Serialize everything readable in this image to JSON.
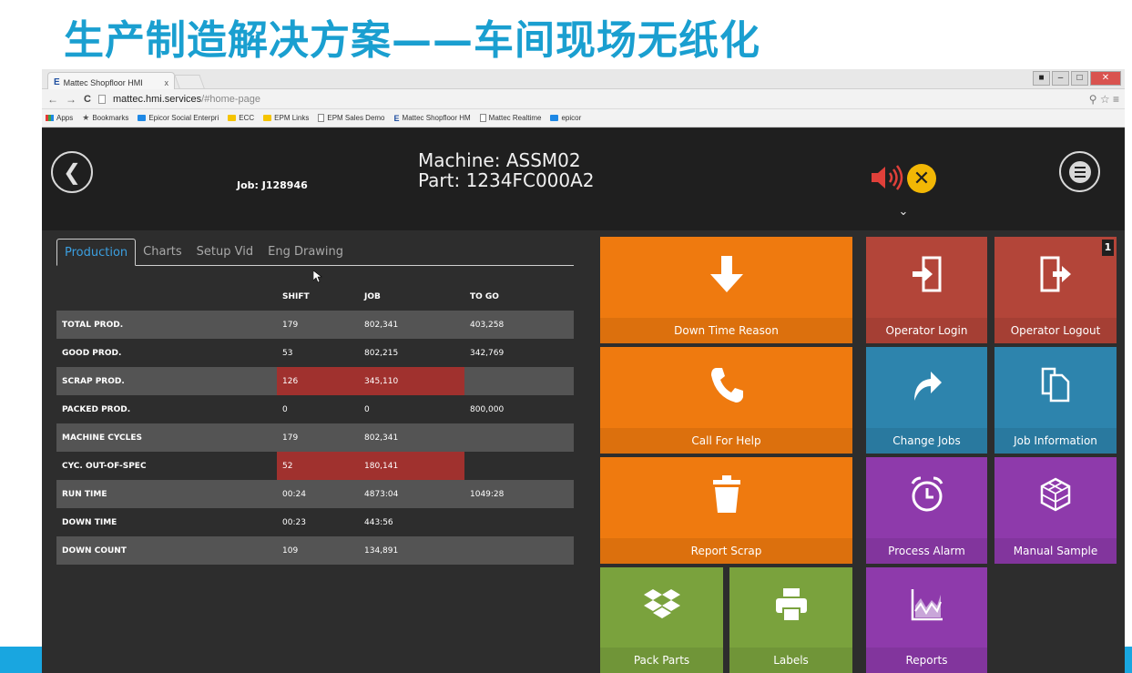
{
  "slide": {
    "title": "生产制造解决方案——车间现场无纸化"
  },
  "browser": {
    "tab_title": "Mattec Shopfloor HMI",
    "tab_close": "x",
    "url_host": "mattec.hmi.services",
    "url_path": "/#home-page",
    "bookmarks": [
      "Apps",
      "Bookmarks",
      "Epicor Social Enterpri",
      "ECC",
      "EPM Links",
      "EPM Sales Demo",
      "Mattec Shopfloor HM",
      "Mattec Realtime",
      "epicor"
    ]
  },
  "header": {
    "job": "Job: J128946",
    "machine": "Machine: ASSM02",
    "part": "Part: 1234FC000A2"
  },
  "tabs": [
    {
      "label": "Production",
      "active": true
    },
    {
      "label": "Charts",
      "active": false
    },
    {
      "label": "Setup Vid",
      "active": false
    },
    {
      "label": "Eng Drawing",
      "active": false
    }
  ],
  "table": {
    "columns": [
      "SHIFT",
      "JOB",
      "TO GO"
    ],
    "rows": [
      {
        "label": "TOTAL PROD.",
        "shift": "179",
        "job": "802,341",
        "togo": "403,258",
        "alert": false
      },
      {
        "label": "GOOD PROD.",
        "shift": "53",
        "job": "802,215",
        "togo": "342,769",
        "alert": false
      },
      {
        "label": "SCRAP PROD.",
        "shift": "126",
        "job": "345,110",
        "togo": "",
        "alert": true
      },
      {
        "label": "PACKED PROD.",
        "shift": "0",
        "job": "0",
        "togo": "800,000",
        "alert": false
      },
      {
        "label": "MACHINE CYCLES",
        "shift": "179",
        "job": "802,341",
        "togo": "",
        "alert": false
      },
      {
        "label": "CYC. OUT-OF-SPEC",
        "shift": "52",
        "job": "180,141",
        "togo": "",
        "alert": true
      },
      {
        "label": "RUN TIME",
        "shift": "00:24",
        "job": "4873:04",
        "togo": "1049:28",
        "alert": false
      },
      {
        "label": "DOWN TIME",
        "shift": "00:23",
        "job": "443:56",
        "togo": "",
        "alert": false
      },
      {
        "label": "DOWN COUNT",
        "shift": "109",
        "job": "134,891",
        "togo": "",
        "alert": false
      }
    ]
  },
  "tiles": {
    "down_time_reason": {
      "label": "Down Time Reason",
      "icon": "arrow-down-icon"
    },
    "operator_login": {
      "label": "Operator Login",
      "icon": "login-door-icon"
    },
    "operator_logout": {
      "label": "Operator Logout",
      "icon": "logout-door-icon",
      "badge": "1"
    },
    "call_for_help": {
      "label": "Call For Help",
      "icon": "phone-icon"
    },
    "change_jobs": {
      "label": "Change Jobs",
      "icon": "share-arrow-icon"
    },
    "job_information": {
      "label": "Job Information",
      "icon": "documents-icon"
    },
    "report_scrap": {
      "label": "Report Scrap",
      "icon": "trash-icon"
    },
    "process_alarm": {
      "label": "Process Alarm",
      "icon": "alarm-clock-icon"
    },
    "manual_sample": {
      "label": "Manual Sample",
      "icon": "cube-icon"
    },
    "pack_parts": {
      "label": "Pack Parts",
      "icon": "package-icon"
    },
    "labels": {
      "label": "Labels",
      "icon": "printer-icon"
    },
    "reports": {
      "label": "Reports",
      "icon": "area-chart-icon"
    }
  },
  "colors": {
    "orange": "#ef7a0f",
    "red": "#b34539",
    "blue": "#2d84ad",
    "purple": "#8e3aab",
    "green": "#7aa23d",
    "alert": "#a0312e",
    "active_tab": "#3b9fe0",
    "title": "#1a9fd0"
  }
}
